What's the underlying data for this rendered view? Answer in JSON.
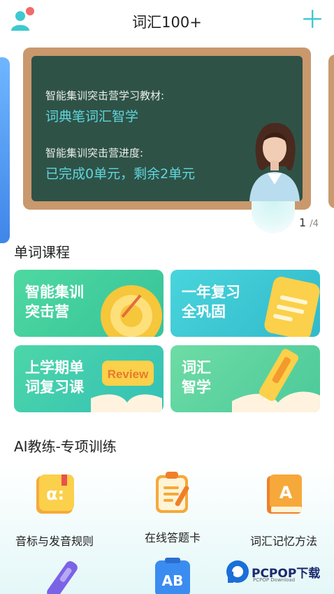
{
  "header": {
    "title": "词汇100+",
    "avatar_icon": "user-avatar-icon",
    "add_icon": "plus-icon",
    "accent": "#3ec9cf"
  },
  "banner": {
    "material_label": "智能集训突击营学习教材:",
    "material_value": "词典笔词汇智学",
    "progress_label": "智能集训突击营进度:",
    "progress_value": "已完成0单元，剩余2单元",
    "page_current": "1",
    "page_total": "/4"
  },
  "courses": {
    "title": "单词课程",
    "items": [
      {
        "label": "智能集训突击营",
        "line1": "智能集训",
        "line2": "突击营",
        "color": "#4fd39c"
      },
      {
        "label": "一年复习全巩固",
        "line1": "一年复习",
        "line2": "全巩固",
        "color": "#3cc8d4"
      },
      {
        "label": "上学期单词复习课",
        "line1": "上学期单",
        "line2": "词复习课",
        "badge": "Review",
        "color": "#44d0b3"
      },
      {
        "label": "词汇智学",
        "line1": "词汇",
        "line2": "智学",
        "color": "#63d7a0"
      }
    ]
  },
  "ai": {
    "title": "AI教练-专项训练",
    "items": [
      {
        "label": "音标与发音规则",
        "icon": "phonetic-book-icon"
      },
      {
        "label": "在线答题卡",
        "icon": "answer-sheet-icon"
      },
      {
        "label": "词汇记忆方法",
        "icon": "vocabulary-book-icon"
      }
    ]
  },
  "watermark": {
    "text": "PCPOP下载",
    "sub": "PCPOP Download"
  }
}
